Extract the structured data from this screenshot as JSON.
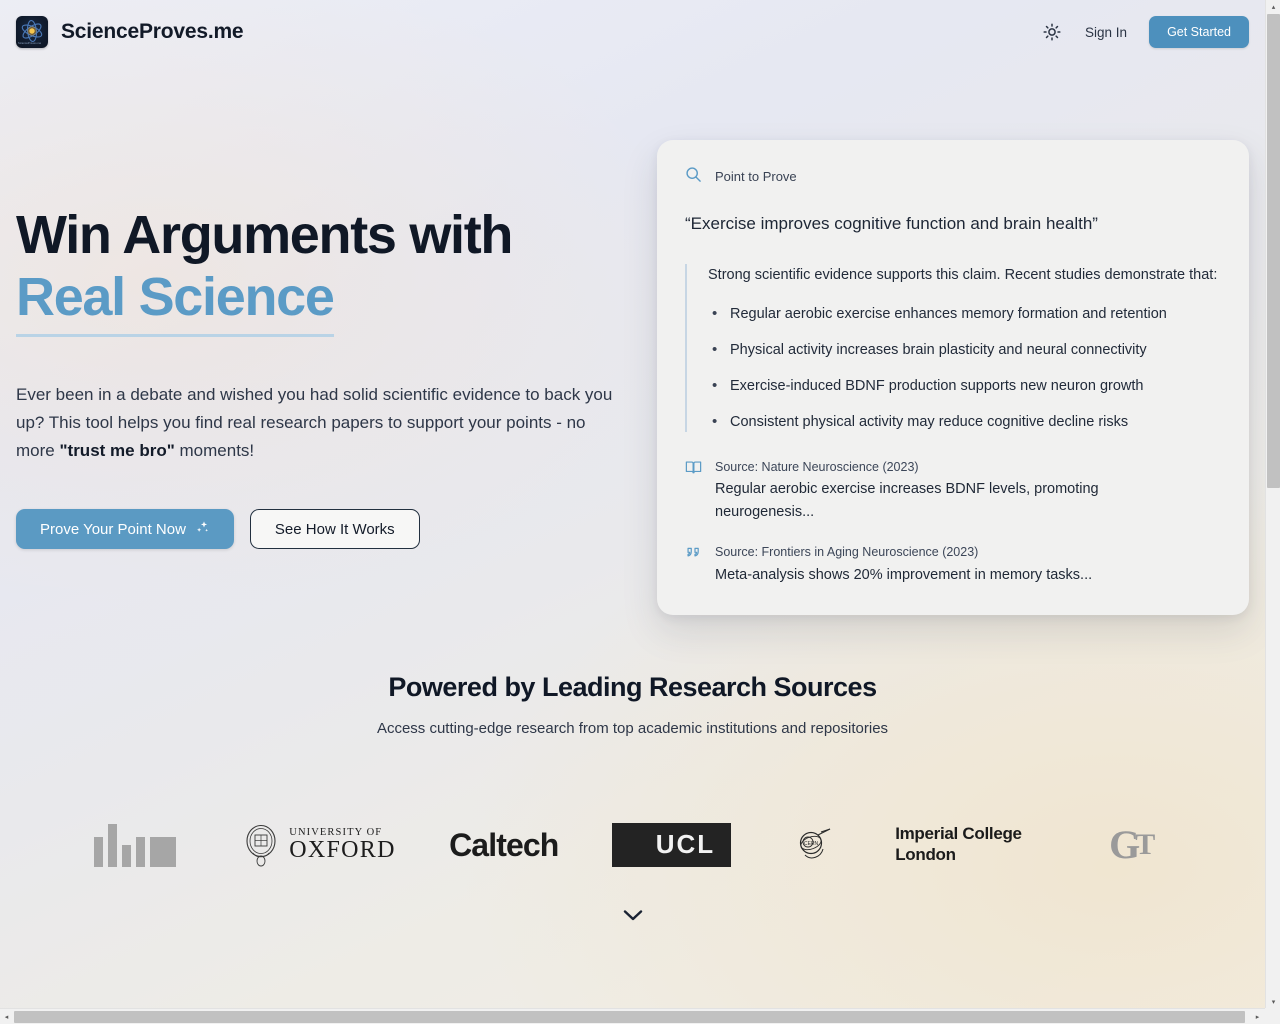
{
  "header": {
    "brand_name": "ScienceProves.me",
    "brand_mark_micro": "ScienceProves.me",
    "theme_toggle_icon": "sun-icon",
    "sign_in_label": "Sign In",
    "get_started_label": "Get Started",
    "accent_color": "#4d90bd"
  },
  "hero": {
    "title_line1": "Win Arguments with",
    "title_line2": "Real Science",
    "accent_color": "#5b9bc6",
    "subtitle_part1": "Ever been in a debate and wished you had solid scientific evidence to back you up? This tool helps you find real research papers to support your points - no more ",
    "subtitle_emphasis": "\"trust me bro\"",
    "subtitle_part2": " moments!",
    "primary_button_label": "Prove Your Point Now",
    "primary_button_icon": "sparkles-icon",
    "secondary_button_label": "See How It Works"
  },
  "demo_card": {
    "label": "Point to Prove",
    "label_icon": "search-icon",
    "claim": "“Exercise improves cognitive function and brain health”",
    "evidence_intro": "Strong scientific evidence supports this claim. Recent studies demonstrate that:",
    "bullets": [
      "Regular aerobic exercise enhances memory formation and retention",
      "Physical activity increases brain plasticity and neural connectivity",
      "Exercise-induced BDNF production supports new neuron growth",
      "Consistent physical activity may reduce cognitive decline risks"
    ],
    "sources": [
      {
        "icon": "book-open-icon",
        "title": "Source: Nature Neuroscience (2023)",
        "snippet": "Regular aerobic exercise increases BDNF levels, promoting neurogenesis..."
      },
      {
        "icon": "quote-icon",
        "title": "Source: Frontiers in Aging Neuroscience (2023)",
        "snippet": "Meta-analysis shows 20% improvement in memory tasks..."
      }
    ]
  },
  "sources_section": {
    "title": "Powered by Leading Research Sources",
    "subtitle": "Access cutting-edge research from top academic institutions and repositories",
    "logos": [
      {
        "name": "MIT",
        "kind": "mit"
      },
      {
        "name": "UNIVERSITY OF OXFORD",
        "kind": "oxford",
        "line1": "UNIVERSITY OF",
        "line2": "OXFORD"
      },
      {
        "name": "Caltech",
        "kind": "caltech",
        "text": "Caltech"
      },
      {
        "name": "UCL",
        "kind": "ucl",
        "text": "UCL"
      },
      {
        "name": "CERN",
        "kind": "cern"
      },
      {
        "name": "Imperial College London",
        "kind": "imperial",
        "line1": "Imperial College",
        "line2": "London"
      },
      {
        "name": "Georgia Tech",
        "kind": "gatech",
        "text": "GT"
      }
    ]
  },
  "scroll_cue": {
    "icon": "chevron-down-icon"
  },
  "scrollbars": {
    "vertical_icon_up": "▴",
    "vertical_icon_down": "▾",
    "horizontal_icon_left": "◂",
    "horizontal_icon_right": "▸"
  }
}
